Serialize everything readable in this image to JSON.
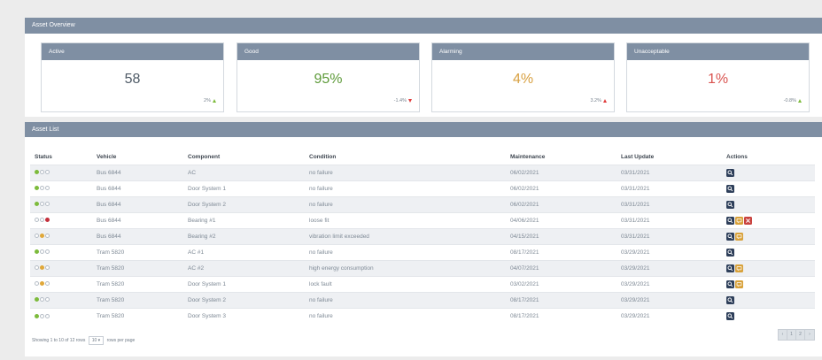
{
  "overview": {
    "title": "Asset Overview",
    "cards": [
      {
        "label": "Active",
        "value": "58",
        "delta": "2%",
        "direction": "up",
        "value_color": "#4e5a66",
        "arrow_color": "#7dbb3c"
      },
      {
        "label": "Good",
        "value": "95%",
        "delta": "-1.4%",
        "direction": "down",
        "value_color": "#5e9b3a",
        "arrow_color": "#e03c3c"
      },
      {
        "label": "Alarming",
        "value": "4%",
        "delta": "3.2%",
        "direction": "up",
        "value_color": "#d8a040",
        "arrow_color": "#e03c3c"
      },
      {
        "label": "Unacceptable",
        "value": "1%",
        "delta": "-0.8%",
        "direction": "up",
        "value_color": "#d9534f",
        "arrow_color": "#7dbb3c"
      }
    ]
  },
  "asset_list": {
    "title": "Asset List",
    "columns": [
      "Status",
      "Vehicle",
      "Component",
      "Condition",
      "Maintenance",
      "Last Update",
      "Actions"
    ],
    "rows": [
      {
        "status": [
          "green",
          "white",
          "white"
        ],
        "vehicle": "Bus 6844",
        "component": "AC",
        "condition": "no failure",
        "maintenance": "06/02/2021",
        "last_update": "03/31/2021",
        "actions": [
          "search"
        ]
      },
      {
        "status": [
          "green",
          "white",
          "white"
        ],
        "vehicle": "Bus 6844",
        "component": "Door System 1",
        "condition": "no failure",
        "maintenance": "06/02/2021",
        "last_update": "03/31/2021",
        "actions": [
          "search"
        ]
      },
      {
        "status": [
          "green",
          "white",
          "white"
        ],
        "vehicle": "Bus 6844",
        "component": "Door System 2",
        "condition": "no failure",
        "maintenance": "06/02/2021",
        "last_update": "03/31/2021",
        "actions": [
          "search"
        ]
      },
      {
        "status": [
          "white",
          "white",
          "red"
        ],
        "vehicle": "Bus 6844",
        "component": "Bearing #1",
        "condition": "loose fit",
        "maintenance": "04/06/2021",
        "last_update": "03/31/2021",
        "actions": [
          "search",
          "message",
          "close"
        ]
      },
      {
        "status": [
          "white",
          "yellow",
          "white"
        ],
        "vehicle": "Bus 6844",
        "component": "Bearing #2",
        "condition": "vibration limit exceeded",
        "maintenance": "04/15/2021",
        "last_update": "03/31/2021",
        "actions": [
          "search",
          "message"
        ]
      },
      {
        "status": [
          "green",
          "white",
          "white"
        ],
        "vehicle": "Tram 5820",
        "component": "AC #1",
        "condition": "no failure",
        "maintenance": "08/17/2021",
        "last_update": "03/29/2021",
        "actions": [
          "search"
        ]
      },
      {
        "status": [
          "white",
          "yellow",
          "white"
        ],
        "vehicle": "Tram 5820",
        "component": "AC #2",
        "condition": "high energy consumption",
        "maintenance": "04/07/2021",
        "last_update": "03/29/2021",
        "actions": [
          "search",
          "message"
        ]
      },
      {
        "status": [
          "white",
          "yellow",
          "white"
        ],
        "vehicle": "Tram 5820",
        "component": "Door System 1",
        "condition": "lock fault",
        "maintenance": "03/02/2021",
        "last_update": "03/29/2021",
        "actions": [
          "search",
          "message"
        ]
      },
      {
        "status": [
          "green",
          "white",
          "white"
        ],
        "vehicle": "Tram 5820",
        "component": "Door System 2",
        "condition": "no failure",
        "maintenance": "08/17/2021",
        "last_update": "03/29/2021",
        "actions": [
          "search"
        ]
      },
      {
        "status": [
          "green",
          "white",
          "white"
        ],
        "vehicle": "Tram 5820",
        "component": "Door System 3",
        "condition": "no failure",
        "maintenance": "08/17/2021",
        "last_update": "03/29/2021",
        "actions": [
          "search"
        ]
      }
    ],
    "footer": {
      "showing_text": "Showing 1 to 10 of 12 rows",
      "page_size": "10",
      "rows_per_page_text": "rows per page"
    },
    "pagination": {
      "prev": "‹",
      "pages": [
        "1",
        "2"
      ],
      "next": "›"
    }
  },
  "colors": {
    "status_green": "#7dbb3c",
    "status_yellow": "#e0a83a",
    "status_red": "#c4303c",
    "action_search": "#2e3f5a",
    "action_message": "#d8a13a",
    "action_close": "#c9433f"
  },
  "icons": {
    "search": "search-icon",
    "message": "message-icon",
    "close": "close-icon"
  }
}
